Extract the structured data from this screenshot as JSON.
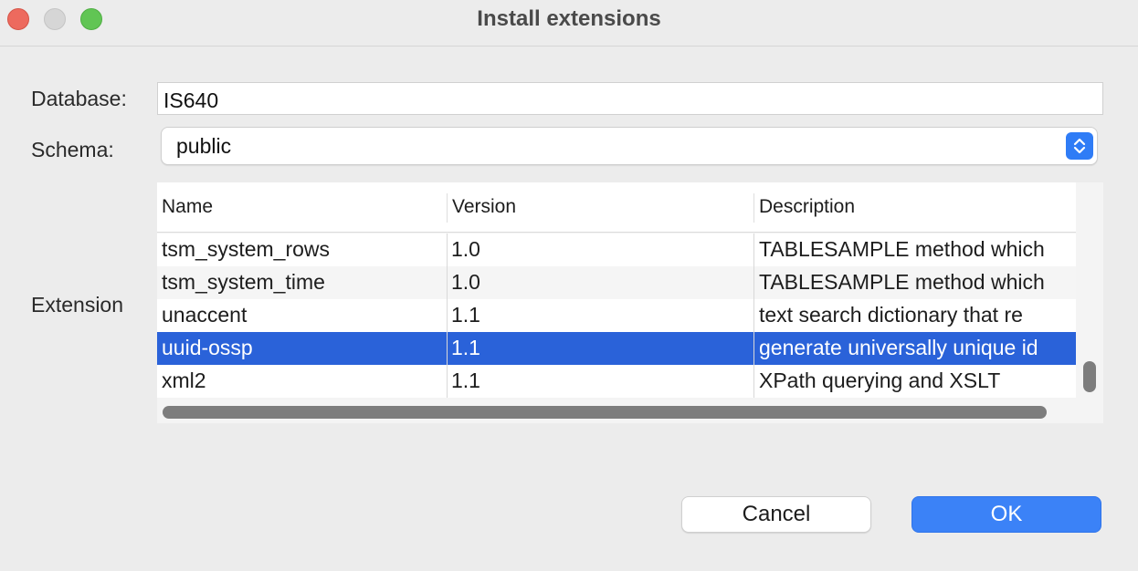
{
  "window": {
    "title": "Install extensions"
  },
  "form": {
    "database_label": "Database:",
    "database_value": "IS640",
    "schema_label": "Schema:",
    "schema_value": "public",
    "extension_label": "Extension"
  },
  "table": {
    "columns": [
      "Name",
      "Version",
      "Description"
    ],
    "rows": [
      {
        "name": "tsm_system_rows",
        "version": "1.0",
        "description": "TABLESAMPLE method which"
      },
      {
        "name": "tsm_system_time",
        "version": "1.0",
        "description": "TABLESAMPLE method which"
      },
      {
        "name": "unaccent",
        "version": "1.1",
        "description": "text search dictionary that re"
      },
      {
        "name": "uuid-ossp",
        "version": "1.1",
        "description": "generate universally unique id",
        "selected": true
      },
      {
        "name": "xml2",
        "version": "1.1",
        "description": "XPath querying and XSLT"
      }
    ]
  },
  "buttons": {
    "cancel": "Cancel",
    "ok": "OK"
  },
  "colors": {
    "selection": "#2a62d9",
    "accent": "#3b82f7",
    "close": "#ed6a5e",
    "zoom": "#61c554"
  },
  "icons": {
    "schema_select": "up-down-chevron-icon"
  }
}
